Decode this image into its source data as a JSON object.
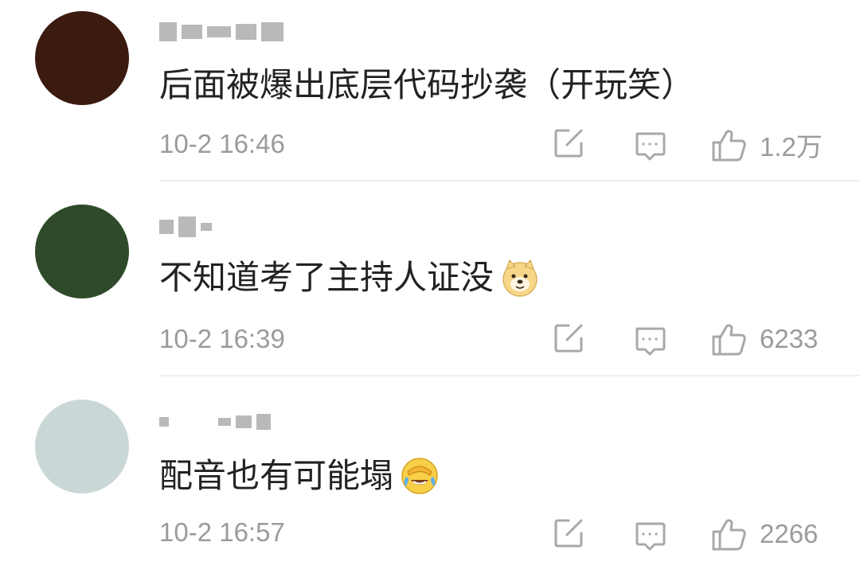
{
  "comments": [
    {
      "text": "后面被爆出底层代码抄袭（开玩笑）",
      "timestamp": "10-2 16:46",
      "likes": "1.2万",
      "emoji": null,
      "username_redacted": true,
      "avatar_colors": [
        "#3b1a10",
        "#a05a3a",
        "#e8dccd",
        "#c9b49a",
        "#5a2c1c",
        "#f3ece2",
        "#8a6a52",
        "#2a1a12"
      ]
    },
    {
      "text": "不知道考了主持人证没",
      "timestamp": "10-2 16:39",
      "likes": "6233",
      "emoji": "doge-emoji",
      "username_redacted": true,
      "avatar_colors": [
        "#2f4a2a",
        "#e89aa8",
        "#f4d0a0",
        "#6a3a3a",
        "#c76a7a",
        "#3e5e38",
        "#f1e6c8",
        "#8ea06a"
      ]
    },
    {
      "text": "配音也有可能塌",
      "timestamp": "10-2 16:57",
      "likes": "2266",
      "emoji": "facepalm-laugh-emoji",
      "username_redacted": true,
      "avatar_colors": [
        "#c9d8d6",
        "#5a4a52",
        "#7a6a6e",
        "#a4a8a0",
        "#3c2e36",
        "#8c8a7a",
        "#e1e6e2",
        "#544650"
      ]
    }
  ],
  "icons": {
    "share": "share-edit-icon",
    "reply": "comment-reply-icon",
    "like": "thumbs-up-icon"
  },
  "colors": {
    "text": "#222222",
    "meta": "#9b9b9b",
    "divider": "#ededed",
    "icon": "#a8a8a8"
  }
}
